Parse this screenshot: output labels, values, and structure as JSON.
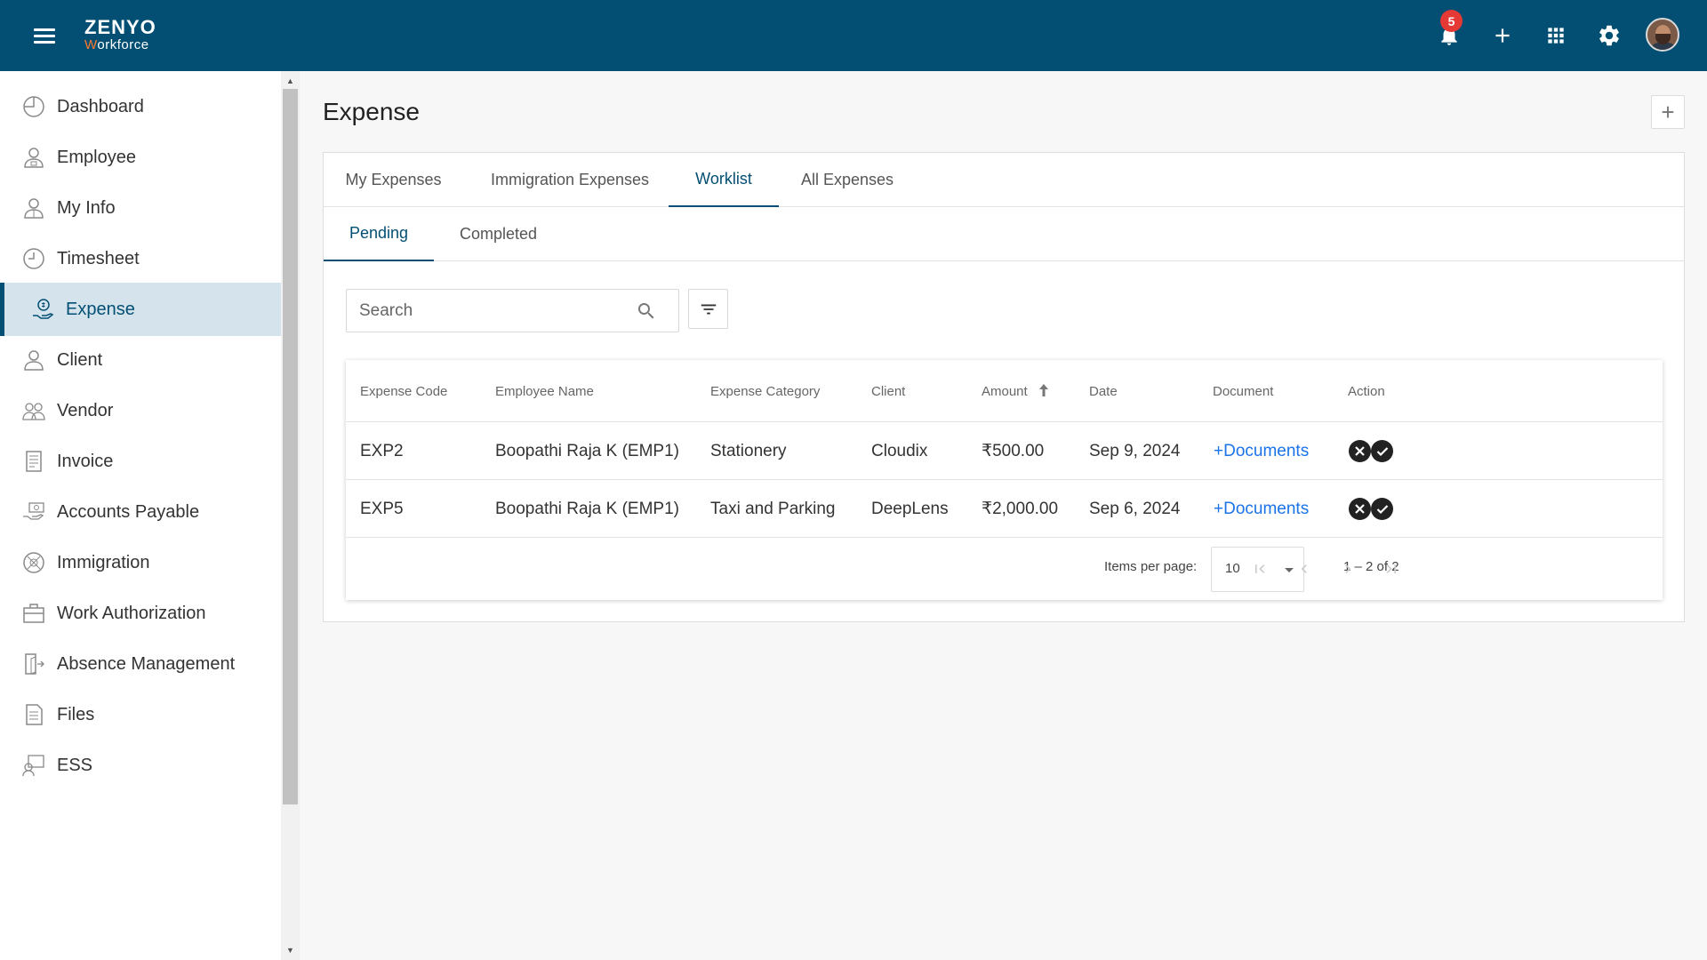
{
  "app": {
    "logo_top": "ZENYO",
    "logo_bottom_accent": "W",
    "logo_bottom_rest": "orkforce",
    "notification_count": "5",
    "icons": [
      "hamburger-menu-icon",
      "bell-icon",
      "plus-icon",
      "apps-grid-icon",
      "gear-icon",
      "user-avatar"
    ]
  },
  "sidebar": {
    "items": [
      {
        "label": "Dashboard",
        "icon": "dashboard-icon"
      },
      {
        "label": "Employee",
        "icon": "employee-icon"
      },
      {
        "label": "My Info",
        "icon": "my-info-icon"
      },
      {
        "label": "Timesheet",
        "icon": "clock-icon"
      },
      {
        "label": "Expense",
        "icon": "expense-icon",
        "active": true
      },
      {
        "label": "Client",
        "icon": "client-icon"
      },
      {
        "label": "Vendor",
        "icon": "vendor-icon"
      },
      {
        "label": "Invoice",
        "icon": "invoice-icon"
      },
      {
        "label": "Accounts Payable",
        "icon": "accounts-payable-icon"
      },
      {
        "label": "Immigration",
        "icon": "globe-icon"
      },
      {
        "label": "Work Authorization",
        "icon": "briefcase-icon"
      },
      {
        "label": "Absence Management",
        "icon": "door-exit-icon"
      },
      {
        "label": "Files",
        "icon": "files-icon"
      },
      {
        "label": "ESS",
        "icon": "ess-icon"
      }
    ]
  },
  "page": {
    "title": "Expense",
    "add_label": "+"
  },
  "tabs": [
    "My Expenses",
    "Immigration Expenses",
    "Worklist",
    "All Expenses"
  ],
  "active_tab": "Worklist",
  "subtabs": [
    "Pending",
    "Completed"
  ],
  "active_subtab": "Pending",
  "search": {
    "placeholder": "Search",
    "value": ""
  },
  "table": {
    "columns": [
      "Expense Code",
      "Employee Name",
      "Expense Category",
      "Client",
      "Amount",
      "Date",
      "Document",
      "Action"
    ],
    "sort_column": "Amount",
    "sort_direction": "ascending",
    "rows": [
      {
        "code": "EXP2",
        "employee": "Boopathi Raja K (EMP1)",
        "category": "Stationery",
        "client": "Cloudix",
        "amount": "₹500.00",
        "date": "Sep 9, 2024",
        "document": "+Documents"
      },
      {
        "code": "EXP5",
        "employee": "Boopathi Raja K (EMP1)",
        "category": "Taxi and Parking",
        "client": "DeepLens",
        "amount": "₹2,000.00",
        "date": "Sep 6, 2024",
        "document": "+Documents"
      }
    ]
  },
  "paginator": {
    "items_per_page_label": "Items per page:",
    "items_per_page": "10",
    "range_label": "1 – 2 of 2"
  },
  "colors": {
    "header_bg": "#034f73",
    "accent": "#034f73",
    "active_item_bg": "#d5e4ec",
    "badge": "#e53935",
    "link": "#1a73e8"
  }
}
